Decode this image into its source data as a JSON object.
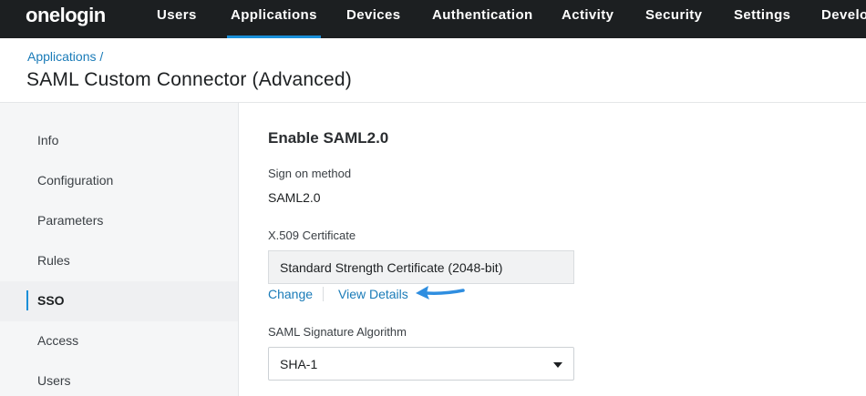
{
  "nav": {
    "logo": "onelogin",
    "items": [
      {
        "label": "Users"
      },
      {
        "label": "Applications",
        "active": true
      },
      {
        "label": "Devices"
      },
      {
        "label": "Authentication"
      },
      {
        "label": "Activity"
      },
      {
        "label": "Security"
      },
      {
        "label": "Settings"
      },
      {
        "label": "Develo"
      }
    ]
  },
  "header": {
    "breadcrumb": "Applications /",
    "title": "SAML Custom Connector (Advanced)"
  },
  "sidebar": {
    "items": [
      {
        "label": "Info"
      },
      {
        "label": "Configuration"
      },
      {
        "label": "Parameters"
      },
      {
        "label": "Rules"
      },
      {
        "label": "SSO",
        "active": true
      },
      {
        "label": "Access"
      },
      {
        "label": "Users"
      }
    ]
  },
  "main": {
    "section_title": "Enable SAML2.0",
    "sign_on": {
      "label": "Sign on method",
      "value": "SAML2.0"
    },
    "certificate": {
      "label": "X.509 Certificate",
      "value": "Standard Strength Certificate (2048-bit)",
      "change_link": "Change",
      "view_link": "View Details"
    },
    "algorithm": {
      "label": "SAML Signature Algorithm",
      "value": "SHA-1"
    }
  },
  "colors": {
    "nav_bg": "#1c1f21",
    "accent": "#1a8fd8",
    "link": "#1a7bb8",
    "arrow": "#2f8ee0"
  }
}
